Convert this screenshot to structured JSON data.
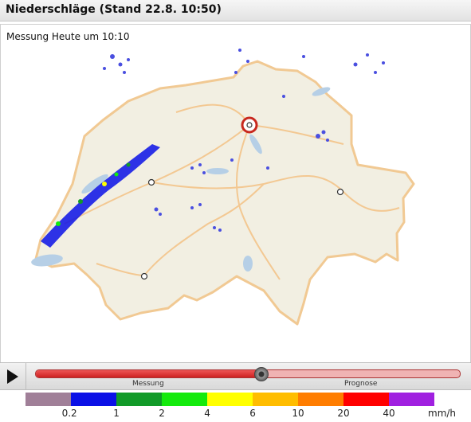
{
  "header": {
    "title": "Niederschläge (Stand 22.8. 10:50)"
  },
  "map": {
    "measurement_label": "Messung Heute um 10:10",
    "colors": {
      "land": "#f2efe2",
      "border": "#f3c892",
      "road": "#f3c892",
      "lake": "#b6cfe6",
      "outside": "#ffffff"
    },
    "highlighted_city_icon": "radar-station-icon"
  },
  "timeline": {
    "play_icon": "play-icon",
    "position_fraction": 0.53,
    "segments": [
      {
        "label": "Messung"
      },
      {
        "label": "Prognose"
      }
    ]
  },
  "legend": {
    "colors": [
      "#a07f98",
      "#0b10e6",
      "#119a28",
      "#14ea0d",
      "#ffff00",
      "#ffbd00",
      "#ff7d00",
      "#ff0000",
      "#a020e0"
    ],
    "ticks": [
      "0.2",
      "1",
      "2",
      "4",
      "6",
      "10",
      "20",
      "40"
    ],
    "unit": "mm/h"
  }
}
